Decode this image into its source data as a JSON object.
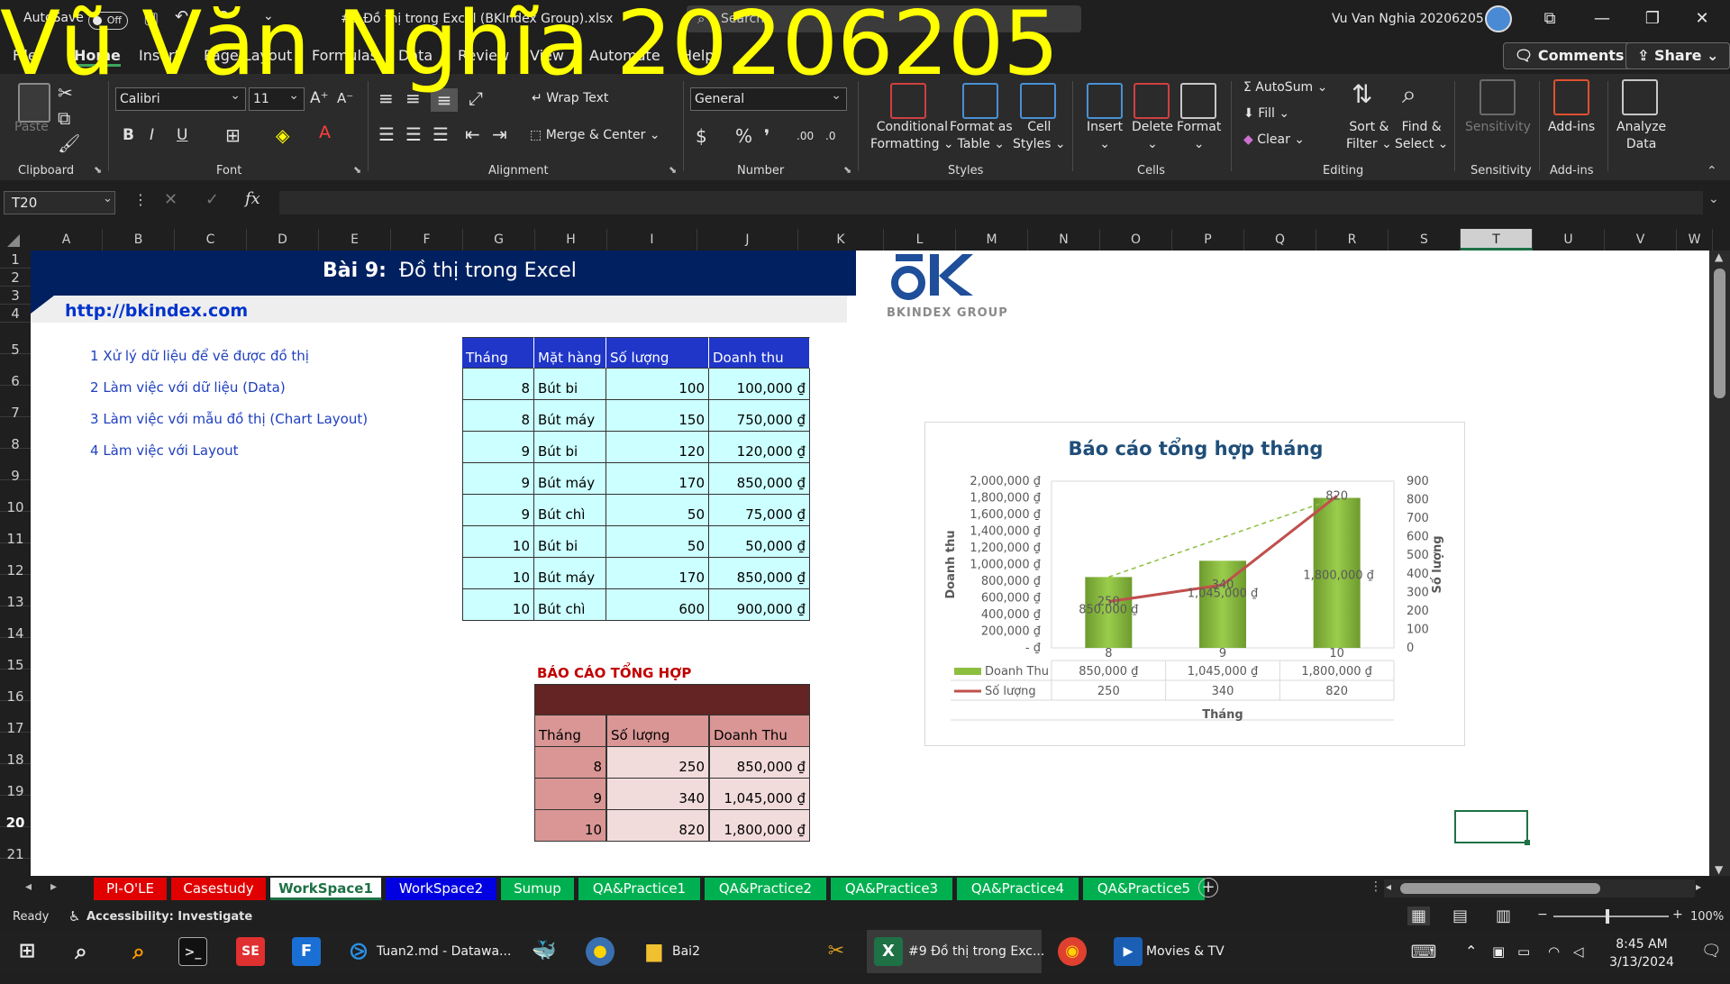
{
  "watermark": "Vũ Văn Nghĩa 20206205",
  "titlebar": {
    "autosave_label": "AutoSave",
    "autosave_state": "Off",
    "file_title": "#9 Đồ thị trong Excel (BKIndex Group).xlsx",
    "search_placeholder": "Search",
    "user_name": "Vu Van Nghia 20206205"
  },
  "ribbon_tabs": [
    "File",
    "Home",
    "Insert",
    "Page Layout",
    "Formulas",
    "Data",
    "Review",
    "View",
    "Automate",
    "Help"
  ],
  "top_buttons": {
    "comments": "Comments",
    "share": "Share"
  },
  "ribbon": {
    "clipboard": {
      "label": "Clipboard",
      "paste": "Paste"
    },
    "font": {
      "label": "Font",
      "name": "Calibri",
      "size": "11"
    },
    "alignment": {
      "label": "Alignment",
      "wrap": "Wrap Text",
      "merge": "Merge & Center"
    },
    "number": {
      "label": "Number",
      "format": "General"
    },
    "styles": {
      "label": "Styles",
      "cond1": "Conditional",
      "cond2": "Formatting",
      "fmt1": "Format as",
      "fmt2": "Table",
      "cell1": "Cell",
      "cell2": "Styles"
    },
    "cells": {
      "label": "Cells",
      "insert": "Insert",
      "delete": "Delete",
      "format": "Format"
    },
    "editing": {
      "label": "Editing",
      "autosum": "AutoSum",
      "fill": "Fill",
      "clear": "Clear",
      "sort1": "Sort &",
      "sort2": "Filter",
      "find1": "Find &",
      "find2": "Select"
    },
    "sensitivity": {
      "label": "Sensitivity",
      "btn": "Sensitivity"
    },
    "addins": {
      "label": "Add-ins",
      "btn": "Add-ins"
    },
    "analyze": {
      "btn1": "Analyze",
      "btn2": "Data"
    }
  },
  "formula_bar": {
    "name_box": "T20",
    "content": ""
  },
  "columns": [
    "A",
    "B",
    "C",
    "D",
    "E",
    "F",
    "G",
    "H",
    "I",
    "J",
    "K",
    "L",
    "M",
    "N",
    "O",
    "P",
    "Q",
    "R",
    "S",
    "T",
    "U",
    "V",
    "W"
  ],
  "selected_column": "T",
  "rows": [
    "1",
    "2",
    "3",
    "4",
    "5",
    "6",
    "7",
    "8",
    "9",
    "10",
    "11",
    "12",
    "13",
    "14",
    "15",
    "16",
    "17",
    "18",
    "19",
    "20",
    "21"
  ],
  "selected_row": "20",
  "sheet": {
    "banner_bold": "Bài 9:",
    "banner_title": "Đồ thị trong Excel",
    "url": "http://bkindex.com",
    "logo_text": "BKINDEX GROUP",
    "toc": [
      {
        "num": "1",
        "text": "Xử lý dữ liệu để vẽ được đồ thị"
      },
      {
        "num": "2",
        "text": "Làm việc với dữ liệu (Data)"
      },
      {
        "num": "3",
        "text": "Làm việc với mẫu đồ thị (Chart Layout)"
      },
      {
        "num": "4",
        "text": "Làm việc với Layout"
      }
    ],
    "table1": {
      "headers": [
        "Tháng",
        "Mặt hàng",
        "Số lượng",
        "Doanh thu"
      ],
      "rows": [
        [
          "8",
          "Bút bi",
          "100",
          "100,000 ₫"
        ],
        [
          "8",
          "Bút máy",
          "150",
          "750,000 ₫"
        ],
        [
          "9",
          "Bút bi",
          "120",
          "120,000 ₫"
        ],
        [
          "9",
          "Bút máy",
          "170",
          "850,000 ₫"
        ],
        [
          "9",
          "Bút chì",
          "50",
          "75,000 ₫"
        ],
        [
          "10",
          "Bút bi",
          "50",
          "50,000 ₫"
        ],
        [
          "10",
          "Bút máy",
          "170",
          "850,000 ₫"
        ],
        [
          "10",
          "Bút chì",
          "600",
          "900,000 ₫"
        ]
      ]
    },
    "table2": {
      "title": "BÁO CÁO TỔNG HỢP",
      "headers": [
        "Tháng",
        "Số lượng",
        "Doanh Thu"
      ],
      "rows": [
        [
          "8",
          "250",
          "850,000 ₫"
        ],
        [
          "9",
          "340",
          "1,045,000 ₫"
        ],
        [
          "10",
          "820",
          "1,800,000 ₫"
        ]
      ]
    }
  },
  "chart_data": {
    "type": "bar",
    "title": "Báo cáo tổng hợp tháng",
    "categories": [
      "8",
      "9",
      "10"
    ],
    "xlabel": "Tháng",
    "ylabel": "Doanh thu",
    "y2label": "Số lượng",
    "ylim": [
      0,
      2000000
    ],
    "y2lim": [
      0,
      900
    ],
    "y_ticks": [
      "- ₫",
      "200,000 ₫",
      "400,000 ₫",
      "600,000 ₫",
      "800,000 ₫",
      "1,000,000 ₫",
      "1,200,000 ₫",
      "1,400,000 ₫",
      "1,600,000 ₫",
      "1,800,000 ₫",
      "2,000,000 ₫"
    ],
    "y2_ticks": [
      "0",
      "100",
      "200",
      "300",
      "400",
      "500",
      "600",
      "700",
      "800",
      "900"
    ],
    "series": [
      {
        "name": "Doanh Thu",
        "type": "bar",
        "axis": "primary",
        "values": [
          850000,
          1045000,
          1800000
        ],
        "labels": [
          "850,000 ₫",
          "1,045,000 ₫",
          "1,800,000 ₫"
        ],
        "color": "#8cbf3f"
      },
      {
        "name": "Số lượng",
        "type": "line",
        "axis": "secondary",
        "values": [
          250,
          340,
          820
        ],
        "labels": [
          "250",
          "340",
          "820"
        ],
        "color": "#c0504d"
      }
    ],
    "trendline": {
      "color": "#8cbf3f",
      "style": "dashed"
    },
    "data_table": true,
    "grid": false
  },
  "sheet_tabs": [
    {
      "name": "PI-O'LE",
      "color": "#e00000",
      "text": "#ffffff"
    },
    {
      "name": "Casestudy",
      "color": "#e00000",
      "text": "#ffffff"
    },
    {
      "name": "WorkSpace1",
      "color": "#ffffff",
      "text": "#1e7145",
      "active": true
    },
    {
      "name": "WorkSpace2",
      "color": "#0000e0",
      "text": "#ffffff"
    },
    {
      "name": "Sumup",
      "color": "#00b050",
      "text": "#ffffff"
    },
    {
      "name": "QA&Practice1",
      "color": "#00b050",
      "text": "#ffffff"
    },
    {
      "name": "QA&Practice2",
      "color": "#00b050",
      "text": "#ffffff"
    },
    {
      "name": "QA&Practice3",
      "color": "#00b050",
      "text": "#ffffff"
    },
    {
      "name": "QA&Practice4",
      "color": "#00b050",
      "text": "#ffffff"
    },
    {
      "name": "QA&Practice5",
      "color": "#00b050",
      "text": "#ffffff"
    }
  ],
  "status": {
    "ready": "Ready",
    "accessibility": "Accessibility: Investigate",
    "zoom": "100%"
  },
  "taskbar": {
    "vscode": "Tuan2.md - Datawa...",
    "folder": "Bai2",
    "excel": "#9 Đồ thị trong Exc...",
    "movies": "Movies & TV",
    "time": "8:45 AM",
    "date": "3/13/2024"
  }
}
